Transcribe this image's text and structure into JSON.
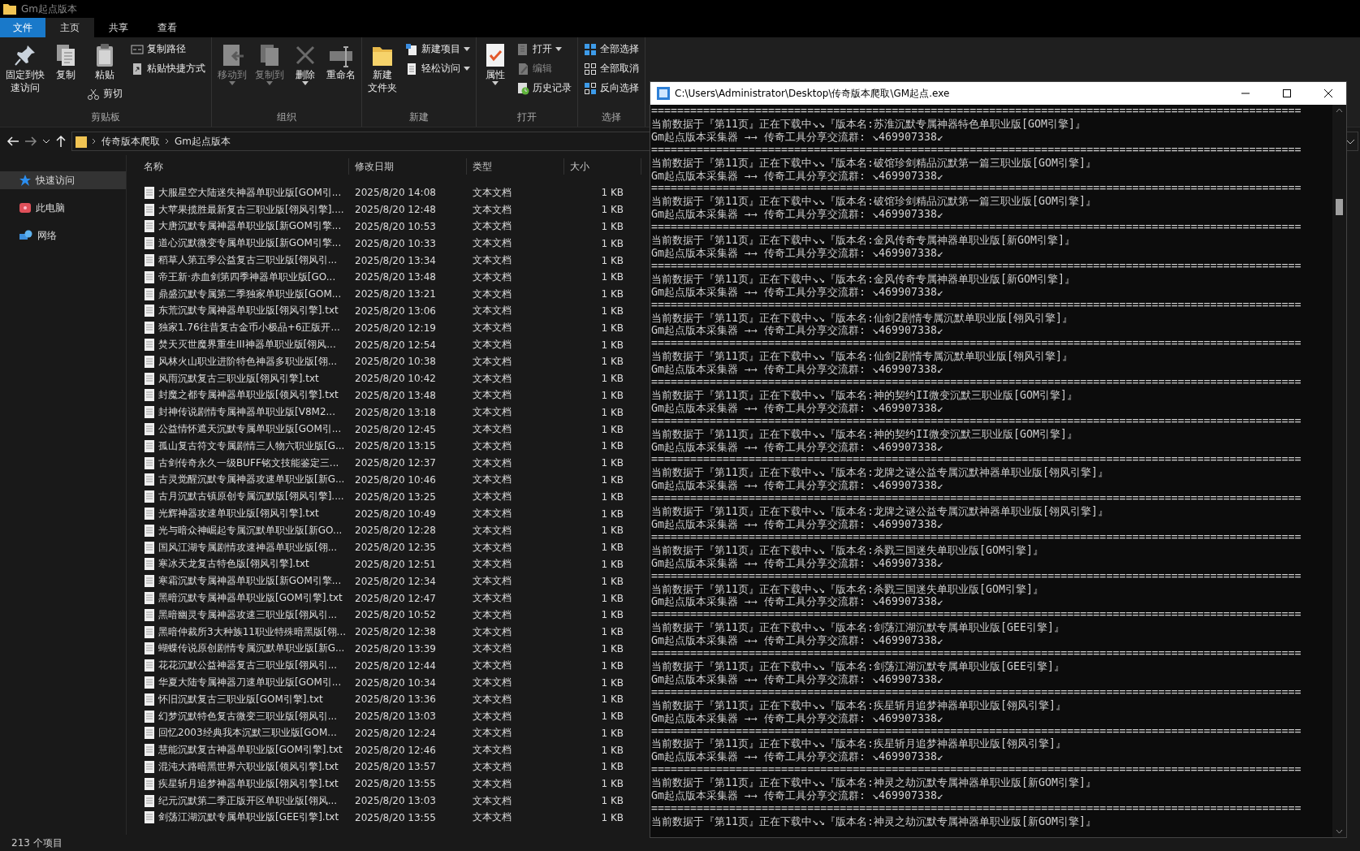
{
  "explorer": {
    "title": "Gm起点版本",
    "tabs": [
      {
        "label": "文件",
        "kind": "file",
        "selected": false
      },
      {
        "label": "主页",
        "kind": "tab",
        "selected": true
      },
      {
        "label": "共享",
        "kind": "tab",
        "selected": false
      },
      {
        "label": "查看",
        "kind": "tab",
        "selected": false
      }
    ],
    "ribbon": {
      "groups": [
        {
          "label": "剪贴板",
          "columns": [
            [
              {
                "lines": [
                  "固定到快",
                  "速访问"
                ],
                "kind": "large",
                "disabled": false,
                "dropdown": false
              }
            ],
            [
              {
                "lines": [
                  "复制"
                ],
                "kind": "large",
                "disabled": false,
                "dropdown": false
              }
            ],
            [
              {
                "lines": [
                  "粘贴"
                ],
                "kind": "large",
                "disabled": false,
                "dropdown": false
              },
              {
                "label": "剪切",
                "kind": "small",
                "disabled": false,
                "dropdown": false
              }
            ],
            [
              {
                "label": "复制路径",
                "kind": "small",
                "disabled": false,
                "dropdown": false
              },
              {
                "label": "粘贴快捷方式",
                "kind": "small",
                "disabled": false,
                "dropdown": false
              }
            ]
          ]
        },
        {
          "label": "组织",
          "columns": [
            [
              {
                "lines": [
                  "移动到"
                ],
                "kind": "large",
                "disabled": true,
                "dropdown": true
              }
            ],
            [
              {
                "lines": [
                  "复制到"
                ],
                "kind": "large",
                "disabled": true,
                "dropdown": true
              }
            ],
            [
              {
                "lines": [
                  "删除"
                ],
                "kind": "large",
                "disabled": false,
                "dropdown": true
              }
            ],
            [
              {
                "lines": [
                  "重命名"
                ],
                "kind": "large",
                "disabled": false,
                "dropdown": false
              }
            ]
          ]
        },
        {
          "label": "新建",
          "columns": [
            [
              {
                "lines": [
                  "新建",
                  "文件夹"
                ],
                "kind": "large",
                "disabled": false,
                "dropdown": false
              }
            ],
            [
              {
                "label": "新建项目",
                "kind": "small",
                "disabled": false,
                "dropdown": true
              },
              {
                "label": "轻松访问",
                "kind": "small",
                "disabled": false,
                "dropdown": true
              }
            ]
          ]
        },
        {
          "label": "打开",
          "columns": [
            [
              {
                "lines": [
                  "属性"
                ],
                "kind": "large",
                "disabled": false,
                "dropdown": true
              }
            ],
            [
              {
                "label": "打开",
                "kind": "small",
                "disabled": false,
                "dropdown": true
              },
              {
                "label": "编辑",
                "kind": "small",
                "disabled": true,
                "dropdown": false
              },
              {
                "label": "历史记录",
                "kind": "small",
                "disabled": false,
                "dropdown": false
              }
            ]
          ]
        },
        {
          "label": "选择",
          "columns": [
            [
              {
                "label": "全部选择",
                "kind": "small",
                "disabled": false,
                "dropdown": false
              },
              {
                "label": "全部取消",
                "kind": "small",
                "disabled": false,
                "dropdown": false
              },
              {
                "label": "反向选择",
                "kind": "small",
                "disabled": false,
                "dropdown": false
              }
            ]
          ]
        }
      ]
    },
    "breadcrumbs": [
      "传奇版本爬取",
      "Gm起点版本"
    ],
    "sidebar": {
      "items": [
        {
          "label": "快速访问",
          "selected": true
        },
        {
          "label": "此电脑",
          "selected": false
        },
        {
          "label": "网络",
          "selected": false
        }
      ]
    },
    "table": {
      "columns": [
        "名称",
        "修改日期",
        "类型",
        "大小"
      ],
      "rows": [
        {
          "name": "大服星空大陆迷失神器单职业版[GOM引...",
          "modified": "2025/8/20 14:08",
          "type": "文本文档",
          "size": "1 KB"
        },
        {
          "name": "大苹果揽胜最新复古三职业版[翎风引擎]....",
          "modified": "2025/8/20 12:48",
          "type": "文本文档",
          "size": "1 KB"
        },
        {
          "name": "大唐沉默专属神器单职业版[新GOM引擎...",
          "modified": "2025/8/20 10:53",
          "type": "文本文档",
          "size": "1 KB"
        },
        {
          "name": "道心沉默微变专属单职业版[新GOM引擎...",
          "modified": "2025/8/20 10:33",
          "type": "文本文档",
          "size": "1 KB"
        },
        {
          "name": "稻草人第五季公益复古三职业版[翎风引...",
          "modified": "2025/8/20 13:34",
          "type": "文本文档",
          "size": "1 KB"
        },
        {
          "name": "帝王新·赤血剑第四季神器单职业版[GO...",
          "modified": "2025/8/20 13:48",
          "type": "文本文档",
          "size": "1 KB"
        },
        {
          "name": "鼎盛沉默专属第二季独家单职业版[GOM...",
          "modified": "2025/8/20 13:21",
          "type": "文本文档",
          "size": "1 KB"
        },
        {
          "name": "东荒沉默专属神器单职业版[翎风引擎].txt",
          "modified": "2025/8/20 13:06",
          "type": "文本文档",
          "size": "1 KB"
        },
        {
          "name": "独家1.76往昔复古金币小极品+6正版开...",
          "modified": "2025/8/20 12:19",
          "type": "文本文档",
          "size": "1 KB"
        },
        {
          "name": "焚天灭世魔界重生III神器单职业版[翎风...",
          "modified": "2025/8/20 12:54",
          "type": "文本文档",
          "size": "1 KB"
        },
        {
          "name": "风林火山职业进阶特色神器多职业版[翎...",
          "modified": "2025/8/20 10:38",
          "type": "文本文档",
          "size": "1 KB"
        },
        {
          "name": "风雨沉默复古三职业版[翎风引擎].txt",
          "modified": "2025/8/20 10:42",
          "type": "文本文档",
          "size": "1 KB"
        },
        {
          "name": "封魔之都专属神器单职业版[领风引擎].txt",
          "modified": "2025/8/20 13:48",
          "type": "文本文档",
          "size": "1 KB"
        },
        {
          "name": "封神传说剧情专属神器单职业版[V8M2...",
          "modified": "2025/8/20 13:18",
          "type": "文本文档",
          "size": "1 KB"
        },
        {
          "name": "公益情怀遮天沉默专属单职业版[GOM引...",
          "modified": "2025/8/20 12:45",
          "type": "文本文档",
          "size": "1 KB"
        },
        {
          "name": "孤山复古符文专属剧情三人物六职业版[G...",
          "modified": "2025/8/20 13:15",
          "type": "文本文档",
          "size": "1 KB"
        },
        {
          "name": "古剑传奇永久一级BUFF铭文技能鉴定三...",
          "modified": "2025/8/20 12:37",
          "type": "文本文档",
          "size": "1 KB"
        },
        {
          "name": "古灵觉醒沉默专属神器攻速单职业版[新G...",
          "modified": "2025/8/20 10:46",
          "type": "文本文档",
          "size": "1 KB"
        },
        {
          "name": "古月沉默古镇原创专属沉默版[翎风引擎]....",
          "modified": "2025/8/20 13:25",
          "type": "文本文档",
          "size": "1 KB"
        },
        {
          "name": "光辉神器攻速单职业版[翎风引擎].txt",
          "modified": "2025/8/20 10:49",
          "type": "文本文档",
          "size": "1 KB"
        },
        {
          "name": "光与暗众神崛起专属沉默单职业版[新GO...",
          "modified": "2025/8/20 12:28",
          "type": "文本文档",
          "size": "1 KB"
        },
        {
          "name": "国风江湖专属剧情攻速神器单职业版[翎...",
          "modified": "2025/8/20 12:35",
          "type": "文本文档",
          "size": "1 KB"
        },
        {
          "name": "寒冰天龙复古特色版[翎风引擎].txt",
          "modified": "2025/8/20 12:51",
          "type": "文本文档",
          "size": "1 KB"
        },
        {
          "name": "寒霜沉默专属神器单职业版[新GOM引擎...",
          "modified": "2025/8/20 12:34",
          "type": "文本文档",
          "size": "1 KB"
        },
        {
          "name": "黑暗沉默专属神器单职业版[GOM引擎].txt",
          "modified": "2025/8/20 12:47",
          "type": "文本文档",
          "size": "1 KB"
        },
        {
          "name": "黑暗幽灵专属神器攻速三职业版[翎风引...",
          "modified": "2025/8/20 10:52",
          "type": "文本文档",
          "size": "1 KB"
        },
        {
          "name": "黑暗仲裁所3大种族11职业特殊暗黑版[翎...",
          "modified": "2025/8/20 12:38",
          "type": "文本文档",
          "size": "1 KB"
        },
        {
          "name": "蝴蝶传说原创剧情专属沉默单职业版[新G...",
          "modified": "2025/8/20 13:39",
          "type": "文本文档",
          "size": "1 KB"
        },
        {
          "name": "花花沉默公益神器复古三职业版[翎风引...",
          "modified": "2025/8/20 12:44",
          "type": "文本文档",
          "size": "1 KB"
        },
        {
          "name": "华夏大陆专属神器刀速单职业版[GOM引...",
          "modified": "2025/8/20 10:34",
          "type": "文本文档",
          "size": "1 KB"
        },
        {
          "name": "怀旧沉默复古三职业版[GOM引擎].txt",
          "modified": "2025/8/20 13:36",
          "type": "文本文档",
          "size": "1 KB"
        },
        {
          "name": "幻梦沉默特色复古微变三职业版[翎风引...",
          "modified": "2025/8/20 13:03",
          "type": "文本文档",
          "size": "1 KB"
        },
        {
          "name": "回忆2003经典我本沉默三职业版[GOM...",
          "modified": "2025/8/20 12:24",
          "type": "文本文档",
          "size": "1 KB"
        },
        {
          "name": "慧能沉默复古神器单职业版[GOM引擎].txt",
          "modified": "2025/8/20 12:46",
          "type": "文本文档",
          "size": "1 KB"
        },
        {
          "name": "混沌大路暗黑世界六职业版[领风引擎].txt",
          "modified": "2025/8/20 13:57",
          "type": "文本文档",
          "size": "1 KB"
        },
        {
          "name": "疾星斩月追梦神器单职业版[翎风引擎].txt",
          "modified": "2025/8/20 13:55",
          "type": "文本文档",
          "size": "1 KB"
        },
        {
          "name": "纪元沉默第二季正版开区单职业版[翎风...",
          "modified": "2025/8/20 13:03",
          "type": "文本文档",
          "size": "1 KB"
        },
        {
          "name": "剑荡江湖沉默专属单职业版[GEE引擎].txt",
          "modified": "2025/8/20 13:55",
          "type": "文本文档",
          "size": "1 KB"
        }
      ]
    },
    "status_bar": "213 个项目"
  },
  "console": {
    "title": "C:\\Users\\Administrator\\Desktop\\传奇版本爬取\\GM起点.exe",
    "blocks": [
      {
        "separator": "====================================================================================================",
        "line1": "当前数据于『第11页』正在下载中↘↘『版本名:苏淮沉默专属神器特色单职业版[GOM引擎]』",
        "line2": "Gm起点版本采集器 →→ 传奇工具分享交流群: ↘469907338↙"
      },
      {
        "separator": "====================================================================================================",
        "line1": "当前数据于『第11页』正在下载中↘↘『版本名:破馆珍剑精品沉默第一篇三职业版[GOM引擎]』",
        "line2": "Gm起点版本采集器 →→ 传奇工具分享交流群: ↘469907338↙"
      },
      {
        "separator": "====================================================================================================",
        "line1": "当前数据于『第11页』正在下载中↘↘『版本名:破馆珍剑精品沉默第一篇三职业版[GOM引擎]』",
        "line2": "Gm起点版本采集器 →→ 传奇工具分享交流群: ↘469907338↙"
      },
      {
        "separator": "====================================================================================================",
        "line1": "当前数据于『第11页』正在下载中↘↘『版本名:金风传奇专属神器单职业版[新GOM引擎]』",
        "line2": "Gm起点版本采集器 →→ 传奇工具分享交流群: ↘469907338↙"
      },
      {
        "separator": "====================================================================================================",
        "line1": "当前数据于『第11页』正在下载中↘↘『版本名:金风传奇专属神器单职业版[新GOM引擎]』",
        "line2": "Gm起点版本采集器 →→ 传奇工具分享交流群: ↘469907338↙"
      },
      {
        "separator": "====================================================================================================",
        "line1": "当前数据于『第11页』正在下载中↘↘『版本名:仙剑2剧情专属沉默单职业版[翎风引擎]』",
        "line2": "Gm起点版本采集器 →→ 传奇工具分享交流群: ↘469907338↙"
      },
      {
        "separator": "====================================================================================================",
        "line1": "当前数据于『第11页』正在下载中↘↘『版本名:仙剑2剧情专属沉默单职业版[翎风引擎]』",
        "line2": "Gm起点版本采集器 →→ 传奇工具分享交流群: ↘469907338↙"
      },
      {
        "separator": "====================================================================================================",
        "line1": "当前数据于『第11页』正在下载中↘↘『版本名:神的契约II微变沉默三职业版[GOM引擎]』",
        "line2": "Gm起点版本采集器 →→ 传奇工具分享交流群: ↘469907338↙"
      },
      {
        "separator": "====================================================================================================",
        "line1": "当前数据于『第11页』正在下载中↘↘『版本名:神的契约II微变沉默三职业版[GOM引擎]』",
        "line2": "Gm起点版本采集器 →→ 传奇工具分享交流群: ↘469907338↙"
      },
      {
        "separator": "====================================================================================================",
        "line1": "当前数据于『第11页』正在下载中↘↘『版本名:龙牌之谜公益专属沉默神器单职业版[翎风引擎]』",
        "line2": "Gm起点版本采集器 →→ 传奇工具分享交流群: ↘469907338↙"
      },
      {
        "separator": "====================================================================================================",
        "line1": "当前数据于『第11页』正在下载中↘↘『版本名:龙牌之谜公益专属沉默神器单职业版[翎风引擎]』",
        "line2": "Gm起点版本采集器 →→ 传奇工具分享交流群: ↘469907338↙"
      },
      {
        "separator": "====================================================================================================",
        "line1": "当前数据于『第11页』正在下载中↘↘『版本名:杀戮三国迷失单职业版[GOM引擎]』",
        "line2": "Gm起点版本采集器 →→ 传奇工具分享交流群: ↘469907338↙"
      },
      {
        "separator": "====================================================================================================",
        "line1": "当前数据于『第11页』正在下载中↘↘『版本名:杀戮三国迷失单职业版[GOM引擎]』",
        "line2": "Gm起点版本采集器 →→ 传奇工具分享交流群: ↘469907338↙"
      },
      {
        "separator": "====================================================================================================",
        "line1": "当前数据于『第11页』正在下载中↘↘『版本名:剑荡江湖沉默专属单职业版[GEE引擎]』",
        "line2": "Gm起点版本采集器 →→ 传奇工具分享交流群: ↘469907338↙"
      },
      {
        "separator": "====================================================================================================",
        "line1": "当前数据于『第11页』正在下载中↘↘『版本名:剑荡江湖沉默专属单职业版[GEE引擎]』",
        "line2": "Gm起点版本采集器 →→ 传奇工具分享交流群: ↘469907338↙"
      },
      {
        "separator": "====================================================================================================",
        "line1": "当前数据于『第11页』正在下载中↘↘『版本名:疾星斩月追梦神器单职业版[翎风引擎]』",
        "line2": "Gm起点版本采集器 →→ 传奇工具分享交流群: ↘469907338↙"
      },
      {
        "separator": "====================================================================================================",
        "line1": "当前数据于『第11页』正在下载中↘↘『版本名:疾星斩月追梦神器单职业版[翎风引擎]』",
        "line2": "Gm起点版本采集器 →→ 传奇工具分享交流群: ↘469907338↙"
      },
      {
        "separator": "====================================================================================================",
        "line1": "当前数据于『第11页』正在下载中↘↘『版本名:神灵之劫沉默专属神器单职业版[新GOM引擎]』",
        "line2": "Gm起点版本采集器 →→ 传奇工具分享交流群: ↘469907338↙"
      },
      {
        "separator": "====================================================================================================",
        "line1": "当前数据于『第11页』正在下载中↘↘『版本名:神灵之劫沉默专属神器单职业版[新GOM引擎]』"
      }
    ]
  }
}
